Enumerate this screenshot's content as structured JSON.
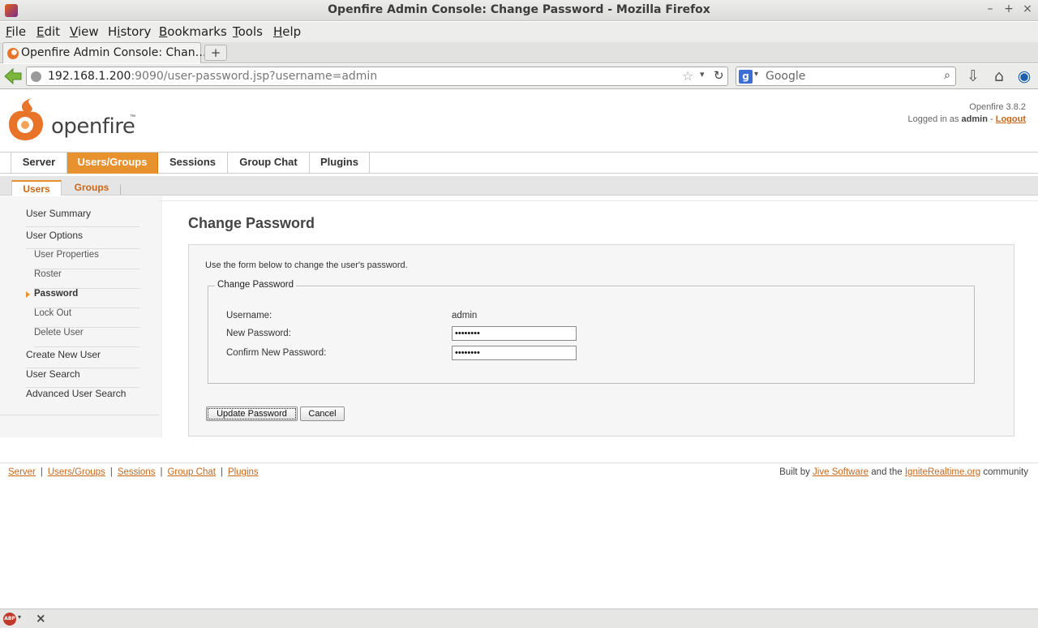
{
  "window": {
    "title": "Openfire Admin Console: Change Password - Mozilla Firefox",
    "minimize": "–",
    "maximize": "+",
    "close": "×"
  },
  "menu": [
    "File",
    "Edit",
    "View",
    "History",
    "Bookmarks",
    "Tools",
    "Help"
  ],
  "menu_mnemonics": [
    "F",
    "E",
    "V",
    "i",
    "B",
    "T",
    "H"
  ],
  "tab": {
    "label": "Openfire Admin Console: Chan…",
    "new_tab": "+"
  },
  "url": {
    "host": "192.168.1.200",
    "rest": ":9090/user-password.jsp?username=admin"
  },
  "search": {
    "engine_icon": "g",
    "placeholder": "Google"
  },
  "header": {
    "brand": "openfire",
    "trademark": "™",
    "version": "Openfire 3.8.2",
    "logged_in_prefix": "Logged in as",
    "user": "admin",
    "logout": "Logout"
  },
  "main_nav": [
    "Server",
    "Users/Groups",
    "Sessions",
    "Group Chat",
    "Plugins"
  ],
  "sub_nav": [
    "Users",
    "Groups"
  ],
  "sidebar": {
    "user_summary": "User Summary",
    "user_options": "User Options",
    "user_properties": "User Properties",
    "roster": "Roster",
    "password": "Password",
    "lock_out": "Lock Out",
    "delete_user": "Delete User",
    "create_new_user": "Create New User",
    "user_search": "User Search",
    "advanced_user_search": "Advanced User Search"
  },
  "content": {
    "title": "Change Password",
    "intro": "Use the form below to change the user's password.",
    "legend": "Change Password",
    "username_label": "Username:",
    "username_value": "admin",
    "new_password_label": "New Password:",
    "new_password_value": "••••••••",
    "confirm_password_label": "Confirm New Password:",
    "confirm_password_value": "••••••••",
    "update_button": "Update Password",
    "cancel_button": "Cancel"
  },
  "footer": {
    "links": [
      "Server",
      "Users/Groups",
      "Sessions",
      "Group Chat",
      "Plugins"
    ],
    "built_by": "Built by",
    "jive": "Jive Software",
    "and_the": "and the",
    "ignite": "IgniteRealtime.org",
    "community": "community"
  },
  "status": {
    "abp": "ABP"
  },
  "colors": {
    "accent": "#e8912f",
    "link": "#c8671a"
  }
}
